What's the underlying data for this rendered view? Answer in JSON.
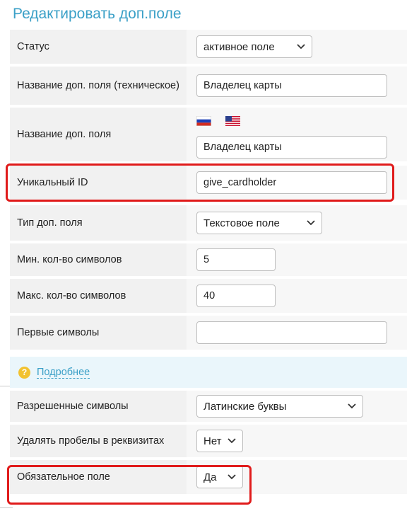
{
  "page": {
    "title": "Редактировать доп.поле"
  },
  "fields": {
    "status": {
      "label": "Статус",
      "value": "активное поле"
    },
    "tech_name": {
      "label": "Название доп. поля (техническое)",
      "value": "Владелец карты"
    },
    "name": {
      "label": "Название доп. поля",
      "value": "Владелец карты",
      "languages": [
        "ru-flag-icon",
        "us-flag-icon"
      ]
    },
    "unique_id": {
      "label": "Уникальный ID",
      "value": "give_cardholder"
    },
    "type": {
      "label": "Тип доп. поля",
      "value": "Текстовое поле"
    },
    "min_chars": {
      "label": "Мин. кол-во символов",
      "value": "5"
    },
    "max_chars": {
      "label": "Макс. кол-во символов",
      "value": "40"
    },
    "first_chars": {
      "label": "Первые символы",
      "value": ""
    },
    "allowed_chars": {
      "label": "Разрешенные символы",
      "value": "Латинские буквы"
    },
    "remove_spaces": {
      "label": "Удалять пробелы в реквизитах",
      "value": "Нет"
    },
    "required": {
      "label": "Обязательное поле",
      "value": "Да"
    }
  },
  "help": {
    "link_text": "Подробнее",
    "icon": "question-icon"
  },
  "colors": {
    "accent": "#3ba0c7",
    "highlight": "#e01b1b",
    "help_icon": "#f2c230"
  }
}
